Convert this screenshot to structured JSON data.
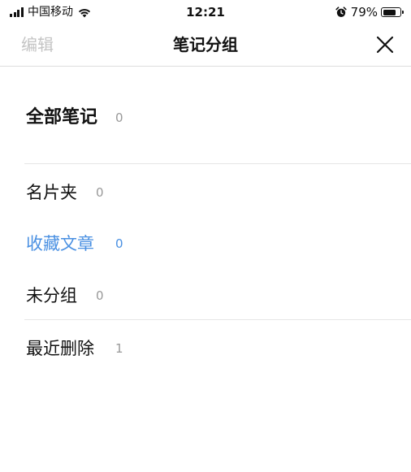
{
  "status_bar": {
    "carrier": "中国移动",
    "time": "12:21",
    "battery_percent": "79%",
    "battery_level": 0.79,
    "icons": [
      "signal-icon",
      "wifi-icon",
      "alarm-icon",
      "battery-icon"
    ]
  },
  "nav": {
    "edit_label": "编辑",
    "title": "笔记分组",
    "close_icon": "close-icon",
    "edit_color": "#c4c4c4"
  },
  "groups": [
    {
      "label": "全部笔记",
      "count": "0"
    },
    {
      "label": "名片夹",
      "count": "0"
    },
    {
      "label": "收藏文章",
      "count": "0",
      "selected": true
    },
    {
      "label": "未分组",
      "count": "0"
    },
    {
      "label": "最近删除",
      "count": "1"
    }
  ],
  "colors": {
    "accent": "#4a90e2",
    "text": "#111111",
    "muted": "#999999",
    "divider": "#e6e6e6"
  }
}
